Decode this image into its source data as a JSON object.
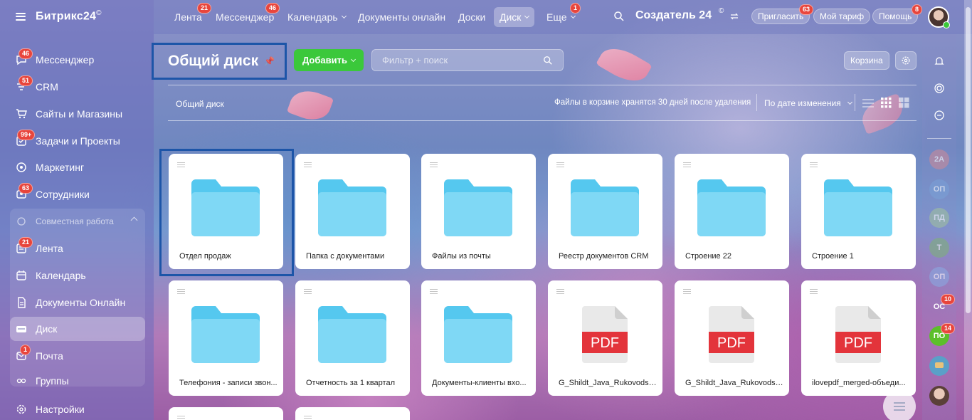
{
  "app": {
    "logo": "Битрикс24",
    "logo_mark": "©"
  },
  "sidebar": {
    "items": [
      {
        "label": "Мессенджер",
        "icon": "chat-icon",
        "badge": "46"
      },
      {
        "label": "CRM",
        "icon": "crm-filter-icon",
        "badge": "51"
      },
      {
        "label": "Сайты и Магазины",
        "icon": "cart-icon",
        "badge": ""
      },
      {
        "label": "Задачи и Проекты",
        "icon": "tasks-icon",
        "badge": "99+"
      },
      {
        "label": "Маркетинг",
        "icon": "target-icon",
        "badge": ""
      },
      {
        "label": "Сотрудники",
        "icon": "people-icon",
        "badge": "63"
      }
    ],
    "group_title": "Совместная работа",
    "group_items": [
      {
        "label": "Лента",
        "icon": "feed-icon",
        "badge": "21"
      },
      {
        "label": "Календарь",
        "icon": "calendar-icon",
        "badge": ""
      },
      {
        "label": "Документы Онлайн",
        "icon": "document-icon",
        "badge": ""
      },
      {
        "label": "Диск",
        "icon": "disk-icon",
        "badge": "",
        "active": true
      },
      {
        "label": "Почта",
        "icon": "mail-icon",
        "badge": "1"
      },
      {
        "label": "Группы",
        "icon": "groups-icon",
        "badge": ""
      }
    ],
    "settings_label": "Настройки"
  },
  "topnav": {
    "items": [
      {
        "label": "Лента",
        "badge": "21"
      },
      {
        "label": "Мессенджер",
        "badge": "46"
      },
      {
        "label": "Календарь",
        "badge": ""
      },
      {
        "label": "Документы онлайн",
        "badge": ""
      },
      {
        "label": "Доски",
        "badge": ""
      },
      {
        "label": "Диск",
        "badge": "",
        "active": true
      },
      {
        "label": "Еще",
        "badge": "1"
      }
    ],
    "creator": "Создатель 24",
    "invite": {
      "label": "Пригласить",
      "badge": "63"
    },
    "tariff": "Мой тариф",
    "help": {
      "label": "Помощь",
      "badge": "8"
    }
  },
  "page": {
    "title": "Общий диск",
    "add_button": "Добавить",
    "search_placeholder": "Фильтр + поиск",
    "trash_button": "Корзина",
    "breadcrumb": "Общий диск",
    "trash_note": "Файлы в корзине хранятся 30 дней после удаления",
    "sort_label": "По дате изменения"
  },
  "files": [
    {
      "name": "Отдел продаж",
      "type": "folder"
    },
    {
      "name": "Папка с документами",
      "type": "folder"
    },
    {
      "name": "Файлы из почты",
      "type": "folder"
    },
    {
      "name": "Реестр документов CRM",
      "type": "folder"
    },
    {
      "name": "Строение 22",
      "type": "folder"
    },
    {
      "name": "Строение 1",
      "type": "folder"
    },
    {
      "name": "Телефония - записи звон...",
      "type": "folder"
    },
    {
      "name": "Отчетность за 1 квартал",
      "type": "folder"
    },
    {
      "name": "Документы-клиенты вхо...",
      "type": "folder"
    },
    {
      "name": "G_Shildt_Java_Rukovodstv...",
      "type": "pdf"
    },
    {
      "name": "G_Shildt_Java_Rukovodstv...",
      "type": "pdf"
    },
    {
      "name": "ilovepdf_merged-объеди...",
      "type": "pdf"
    }
  ],
  "pdf_label": "PDF",
  "right_rail": [
    {
      "text": "2A",
      "color": "#c98a9a",
      "badge": ""
    },
    {
      "text": "ОП",
      "color": "#7aa0d6",
      "badge": ""
    },
    {
      "text": "ПД",
      "color": "#9fc0a0",
      "badge": ""
    },
    {
      "text": "Т",
      "color": "#7fb07a",
      "badge": ""
    },
    {
      "text": "ОП",
      "color": "#8aa8e0",
      "badge": ""
    },
    {
      "text": "ОС",
      "color": "#ffffff",
      "badge": "10"
    },
    {
      "text": "ПО",
      "color": "#5cbf2a",
      "badge": "14"
    }
  ],
  "colors": {
    "accent_green": "#3bc83b",
    "folder_blue": "#7fd8f5",
    "pdf_red": "#e3343b",
    "badge_red": "#e8453c",
    "highlight_border": "#1d55a8"
  }
}
